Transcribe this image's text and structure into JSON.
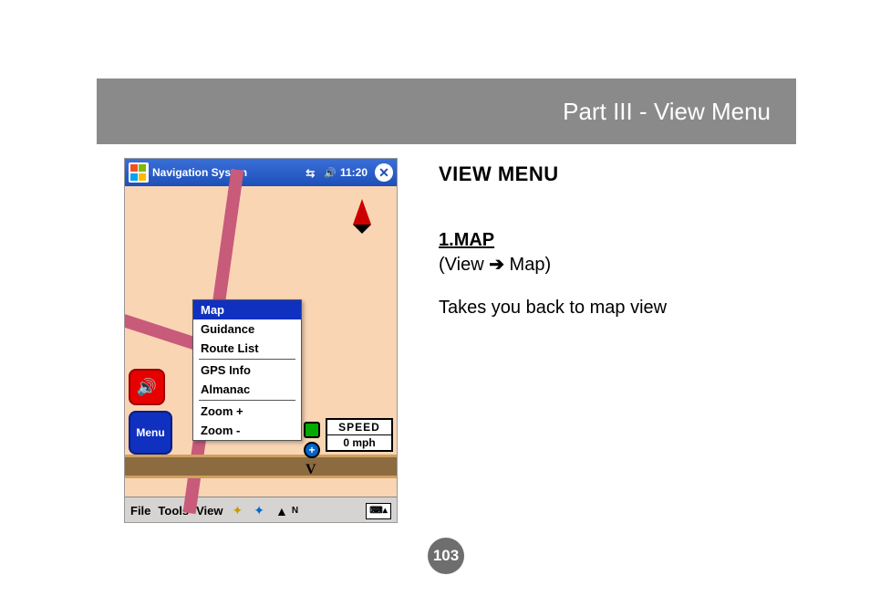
{
  "header": {
    "title": "Part III - View Menu"
  },
  "section": {
    "title": "VIEW MENU",
    "item_number": "1.",
    "item_name": "MAP",
    "path_prefix": "(View ",
    "path_suffix": " Map)",
    "arrow": "➔",
    "body": "Takes you back to map view"
  },
  "page_number": "103",
  "pda": {
    "titlebar": {
      "app": "Navigation Systen",
      "time": "11:20"
    },
    "popup": {
      "selected": "Map",
      "items_a": [
        "Guidance",
        "Route List"
      ],
      "items_b": [
        "GPS Info",
        "Almanac"
      ],
      "items_c": [
        "Zoom +",
        "Zoom -"
      ]
    },
    "speed": {
      "label": "SPEED",
      "value": "0 mph"
    },
    "menu_button": "Menu",
    "menubar": {
      "file": "File",
      "tools": "Tools",
      "view": "View",
      "compass": "N"
    }
  }
}
